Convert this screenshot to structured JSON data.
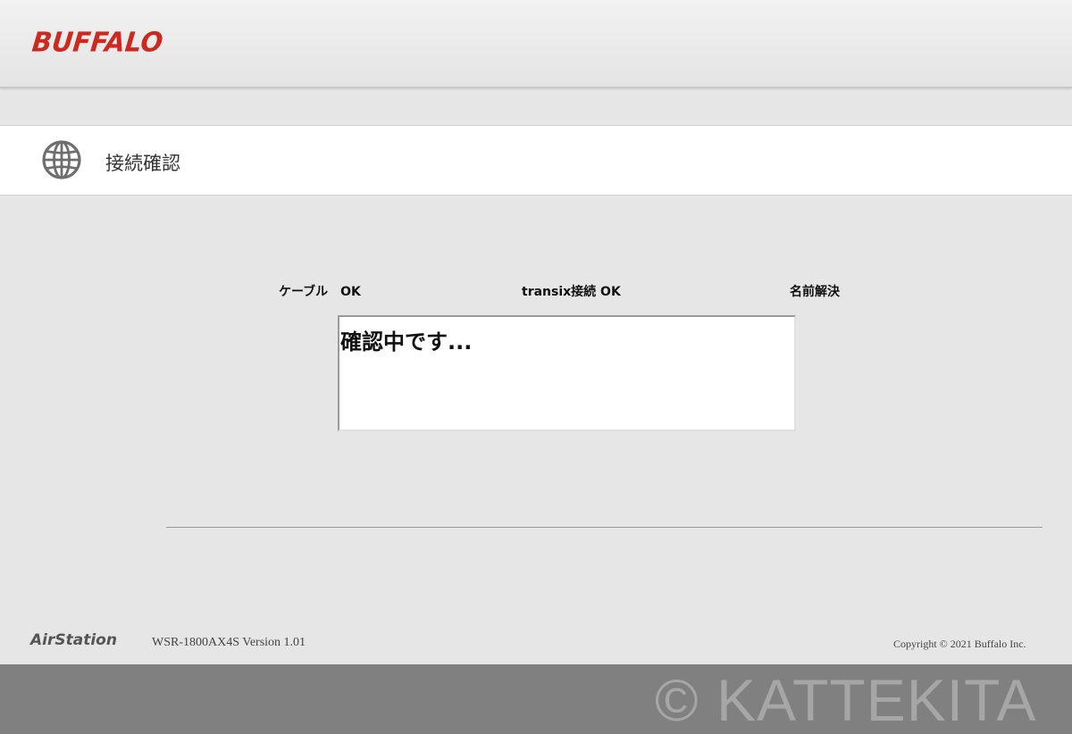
{
  "header": {
    "logo_text": "BUFFALO",
    "brand_color": "#cc2a1f"
  },
  "page": {
    "title": "接続確認",
    "title_icon": "globe-icon"
  },
  "status": {
    "cable": "ケーブル　OK",
    "transix": "transix接続 OK",
    "dns": "名前解決"
  },
  "message": {
    "text": "確認中です..."
  },
  "footer": {
    "product_logo": "AirStation",
    "version": "WSR-1800AX4S Version 1.01",
    "copyright": "Copyright © 2021 Buffalo Inc."
  },
  "watermark": {
    "text": "© KATTEKITA"
  }
}
